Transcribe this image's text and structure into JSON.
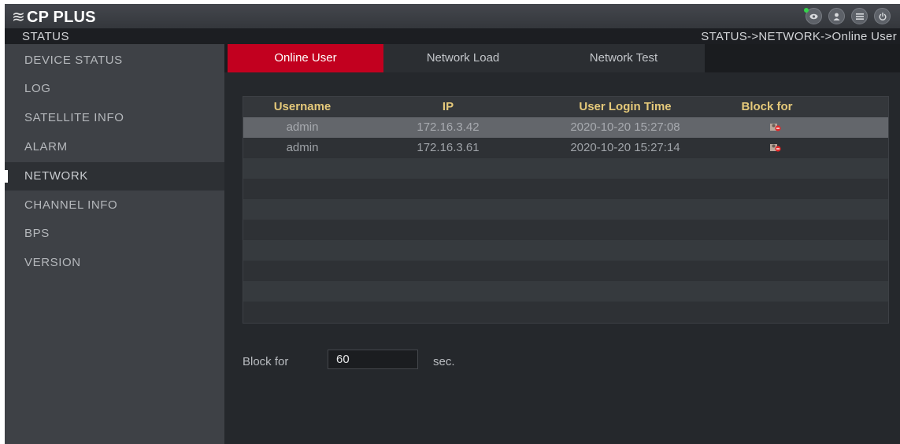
{
  "app": {
    "logo_mark": "≋",
    "logo_text": "CP PLUS",
    "icons": [
      "live-view-icon",
      "user-icon",
      "menu-icon",
      "power-icon"
    ]
  },
  "header": {
    "section_title": "STATUS",
    "breadcrumb": "STATUS->NETWORK->Online User"
  },
  "sidebar": {
    "items": [
      {
        "label": "DEVICE STATUS"
      },
      {
        "label": "LOG"
      },
      {
        "label": "SATELLITE INFO"
      },
      {
        "label": "ALARM"
      },
      {
        "label": "NETWORK",
        "active": true
      },
      {
        "label": "CHANNEL INFO"
      },
      {
        "label": "BPS"
      },
      {
        "label": "VERSION"
      }
    ]
  },
  "tabs": [
    {
      "label": "Online User",
      "active": true
    },
    {
      "label": "Network Load"
    },
    {
      "label": "Network Test"
    }
  ],
  "table": {
    "columns": [
      "Username",
      "IP",
      "User Login Time",
      "Block for"
    ],
    "rows": [
      {
        "username": "admin",
        "ip": "172.16.3.42",
        "login_time": "2020-10-20 15:27:08",
        "block_icon": "block-user-icon",
        "selected": true
      },
      {
        "username": "admin",
        "ip": "172.16.3.61",
        "login_time": "2020-10-20 15:27:14",
        "block_icon": "block-user-icon",
        "selected": false
      }
    ]
  },
  "block": {
    "label": "Block for",
    "value": "60",
    "unit": "sec."
  },
  "colors": {
    "accent": "#c2001f",
    "header_text": "#e5c97a"
  }
}
